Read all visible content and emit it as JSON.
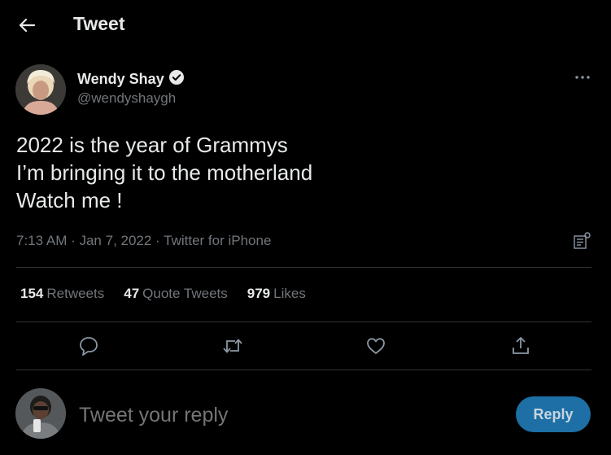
{
  "header": {
    "title": "Tweet"
  },
  "author": {
    "name": "Wendy Shay",
    "handle": "@wendyshaygh"
  },
  "tweet": {
    "lines": [
      "2022 is the year of Grammys",
      "I’m bringing it to the motherland",
      "Watch me !"
    ],
    "meta": "7:13 AM · Jan 7, 2022 · Twitter for iPhone"
  },
  "stats": {
    "retweets_count": "154",
    "retweets_label": "Retweets",
    "quotes_count": "47",
    "quotes_label": "Quote Tweets",
    "likes_count": "979",
    "likes_label": "Likes"
  },
  "reply": {
    "placeholder": "Tweet your reply",
    "button_label": "Reply"
  },
  "colors": {
    "background": "#000000",
    "text": "#e7e9ea",
    "muted": "#71767b",
    "verified": "#e7e9ea",
    "reply_button": "#1d6fa5"
  },
  "icons": [
    "back-arrow-icon",
    "verified-badge-icon",
    "more-icon",
    "analytics-icon",
    "reply-icon",
    "retweet-icon",
    "like-icon",
    "share-icon"
  ]
}
